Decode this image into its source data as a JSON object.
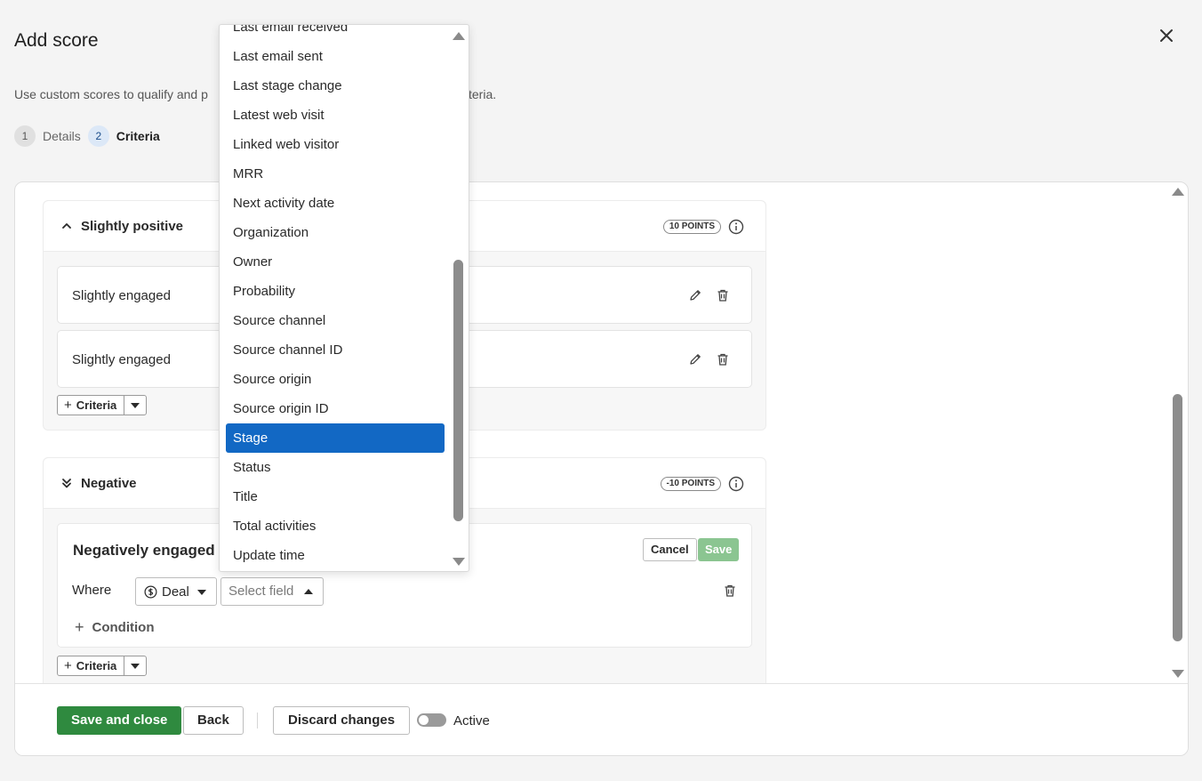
{
  "header": {
    "title": "Add score",
    "subtitle_start": "Use custom scores to qualify and p",
    "subtitle_end": "teria."
  },
  "steps": [
    {
      "number": "1",
      "label": "Details"
    },
    {
      "number": "2",
      "label": "Criteria"
    }
  ],
  "sections": [
    {
      "title": "Slightly positive",
      "points": "10 POINTS",
      "criteria": [
        "Slightly engaged",
        "Slightly engaged"
      ],
      "add_button": "Criteria"
    },
    {
      "title": "Negative",
      "points": "-10 POINTS",
      "add_button": "Criteria",
      "editor": {
        "title": "Negatively engaged",
        "cancel": "Cancel",
        "save": "Save",
        "where": "Where",
        "entity": "Deal",
        "field_placeholder": "Select field",
        "add_condition": "Condition"
      }
    }
  ],
  "dropdown": {
    "items": [
      "Last email received",
      "Last email sent",
      "Last stage change",
      "Latest web visit",
      "Linked web visitor",
      "MRR",
      "Next activity date",
      "Organization",
      "Owner",
      "Probability",
      "Source channel",
      "Source channel ID",
      "Source origin",
      "Source origin ID",
      "Stage",
      "Status",
      "Title",
      "Total activities",
      "Update time"
    ],
    "selected": "Stage"
  },
  "footer": {
    "save_close": "Save and close",
    "back": "Back",
    "discard": "Discard changes",
    "active_label": "Active",
    "active": false
  },
  "colors": {
    "primary_green": "#2f8a3f",
    "selected_blue": "#1268c4",
    "disabled_save": "#8bc591"
  }
}
